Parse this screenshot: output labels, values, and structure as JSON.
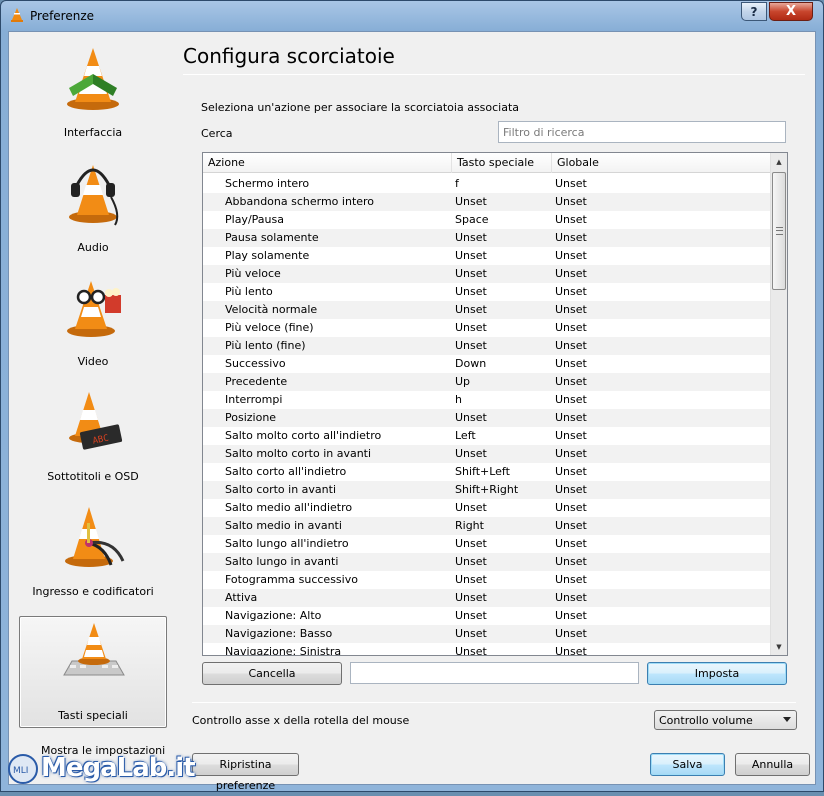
{
  "window": {
    "title": "Preferenze",
    "help": "?",
    "close": "X"
  },
  "sidebar": {
    "items": [
      {
        "label": "Interfaccia",
        "icon": "vlc-cone-icon"
      },
      {
        "label": "Audio",
        "icon": "vlc-cone-headphones-icon"
      },
      {
        "label": "Video",
        "icon": "vlc-cone-glasses-icon"
      },
      {
        "label": "Sottotitoli e OSD",
        "icon": "vlc-cone-subtitles-icon"
      },
      {
        "label": "Ingresso e codificatori",
        "icon": "vlc-cone-cables-icon"
      },
      {
        "label": "Tasti speciali",
        "icon": "vlc-cone-keyboard-icon"
      }
    ],
    "show_settings": "Mostra le impostazioni"
  },
  "main": {
    "title": "Configura scorciatoie",
    "instruction": "Seleziona un'azione per associare la scorciatoia associata",
    "search_label": "Cerca",
    "search_placeholder": "Filtro di ricerca",
    "columns": [
      "Azione",
      "Tasto speciale",
      "Globale"
    ],
    "rows": [
      [
        "Schermo intero",
        "f",
        "Unset"
      ],
      [
        "Abbandona schermo intero",
        "Unset",
        "Unset"
      ],
      [
        "Play/Pausa",
        "Space",
        "Unset"
      ],
      [
        "Pausa solamente",
        "Unset",
        "Unset"
      ],
      [
        "Play solamente",
        "Unset",
        "Unset"
      ],
      [
        "Più veloce",
        "Unset",
        "Unset"
      ],
      [
        "Più lento",
        "Unset",
        "Unset"
      ],
      [
        "Velocità normale",
        "Unset",
        "Unset"
      ],
      [
        "Più veloce (fine)",
        "Unset",
        "Unset"
      ],
      [
        "Più lento (fine)",
        "Unset",
        "Unset"
      ],
      [
        "Successivo",
        "Down",
        "Unset"
      ],
      [
        "Precedente",
        "Up",
        "Unset"
      ],
      [
        "Interrompi",
        "h",
        "Unset"
      ],
      [
        "Posizione",
        "Unset",
        "Unset"
      ],
      [
        "Salto molto corto all'indietro",
        "Left",
        "Unset"
      ],
      [
        "Salto molto corto in avanti",
        "Unset",
        "Unset"
      ],
      [
        "Salto corto all'indietro",
        "Shift+Left",
        "Unset"
      ],
      [
        "Salto corto in avanti",
        "Shift+Right",
        "Unset"
      ],
      [
        "Salto medio all'indietro",
        "Unset",
        "Unset"
      ],
      [
        "Salto medio in avanti",
        "Right",
        "Unset"
      ],
      [
        "Salto lungo all'indietro",
        "Unset",
        "Unset"
      ],
      [
        "Salto lungo in avanti",
        "Unset",
        "Unset"
      ],
      [
        "Fotogramma successivo",
        "Unset",
        "Unset"
      ],
      [
        "Attiva",
        "Unset",
        "Unset"
      ],
      [
        "Navigazione: Alto",
        "Unset",
        "Unset"
      ],
      [
        "Navigazione: Basso",
        "Unset",
        "Unset"
      ],
      [
        "Navigazione: Sinistra",
        "Unset",
        "Unset"
      ]
    ],
    "clear_button": "Cancella",
    "set_button": "Imposta",
    "mouse_label": "Controllo asse x della rotella del mouse",
    "mouse_option": "Controllo volume"
  },
  "footer": {
    "reset_button": "Ripristina preferenze",
    "save_button": "Salva",
    "cancel_button": "Annulla"
  },
  "watermark": {
    "text": "MegaLab.it",
    "badge": "MLI"
  }
}
